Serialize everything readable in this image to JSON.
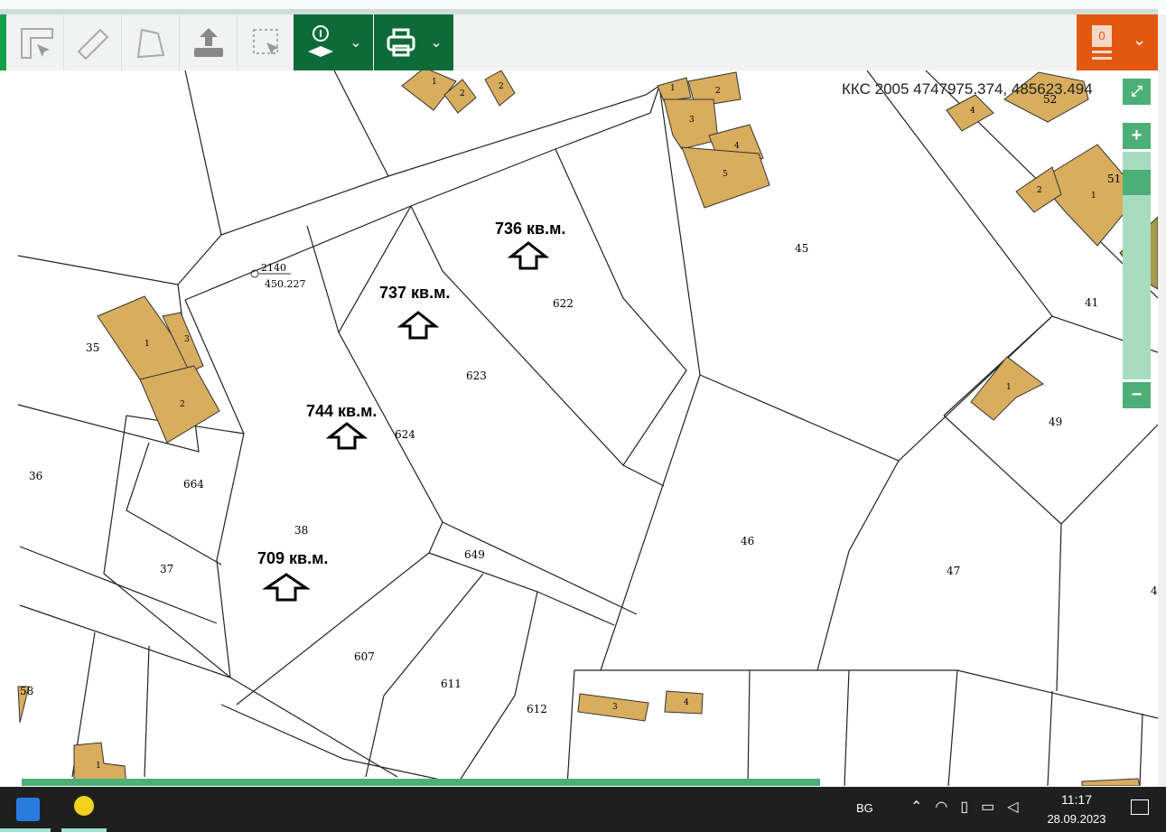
{
  "toolbar": {
    "tools": [
      "coordinates-tool",
      "measure-distance-tool",
      "measure-area-tool",
      "upload-tool",
      "select-area-tool"
    ],
    "info_layers": "info-layers-button",
    "print": "print-button"
  },
  "cart": {
    "count": "0"
  },
  "coords": "ККС 2005 4747975.374, 485623.494",
  "map_controls": {
    "zoom_in": "+",
    "zoom_out": "−"
  },
  "map": {
    "parcels": [
      {
        "id": "45"
      },
      {
        "id": "622"
      },
      {
        "id": "623"
      },
      {
        "id": "624"
      },
      {
        "id": "35"
      },
      {
        "id": "36"
      },
      {
        "id": "664"
      },
      {
        "id": "38"
      },
      {
        "id": "37"
      },
      {
        "id": "649"
      },
      {
        "id": "46"
      },
      {
        "id": "47"
      },
      {
        "id": "49"
      },
      {
        "id": "607"
      },
      {
        "id": "611"
      },
      {
        "id": "612"
      },
      {
        "id": "41"
      },
      {
        "id": "58"
      },
      {
        "id": "4"
      },
      {
        "id": "52"
      },
      {
        "id": "51"
      }
    ],
    "areas": [
      "736 кв.м.",
      "737 кв.м.",
      "744 кв.м.",
      "709 кв.м."
    ],
    "point": {
      "number": "2140",
      "elevation": "450.227"
    },
    "buildings": [
      "1",
      "2",
      "2",
      "1",
      "2",
      "3",
      "4",
      "5",
      "4",
      "1",
      "2",
      "1",
      "3",
      "2",
      "1",
      "3",
      "4",
      "1"
    ]
  },
  "taskbar": {
    "lang": "BG",
    "time": "11:17",
    "date": "28.09.2023"
  }
}
